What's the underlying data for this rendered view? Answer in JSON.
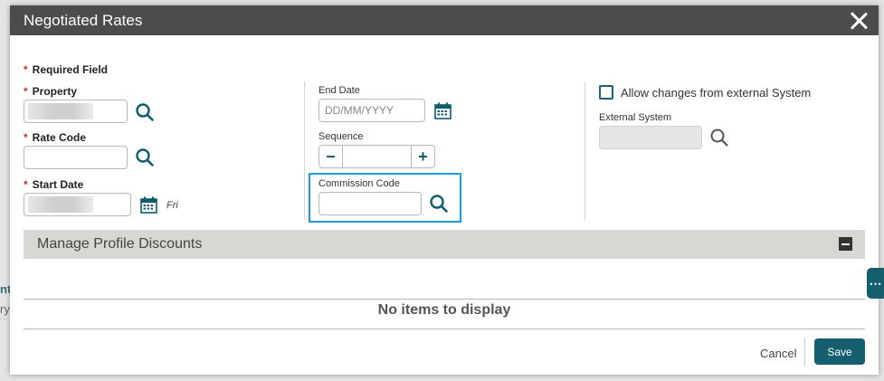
{
  "dialog": {
    "title": "Negotiated Rates",
    "required_note": "Required Field"
  },
  "fields": {
    "property": {
      "label": "Property",
      "required": true
    },
    "rate_code": {
      "label": "Rate Code",
      "required": true,
      "value": ""
    },
    "start_date": {
      "label": "Start Date",
      "required": true,
      "day": "Fri"
    },
    "end_date": {
      "label": "End Date",
      "placeholder": "DD/MM/YYYY",
      "value": ""
    },
    "sequence": {
      "label": "Sequence",
      "value": "",
      "minus": "−",
      "plus": "+"
    },
    "commission_code": {
      "label": "Commission Code",
      "value": ""
    },
    "allow_external": {
      "label": "Allow changes from external System",
      "checked": false
    },
    "external_system": {
      "label": "External System",
      "value": ""
    }
  },
  "profile_discounts": {
    "title": "Manage Profile Discounts",
    "empty_message": "No items to display"
  },
  "footer": {
    "cancel_label": "Cancel",
    "save_label": "Save"
  },
  "side_tab": {
    "label": "⋯"
  },
  "background": {
    "frag_1": "nt",
    "frag_2": "ry"
  },
  "colors": {
    "titlebar": "#4c4c4c",
    "accent": "#155e6e",
    "highlight": "#1f9bd7",
    "required": "#c0392b"
  },
  "icons": [
    "close-icon",
    "search-icon",
    "calendar-icon",
    "minus-icon",
    "plus-icon",
    "collapse-icon",
    "more-icon"
  ]
}
